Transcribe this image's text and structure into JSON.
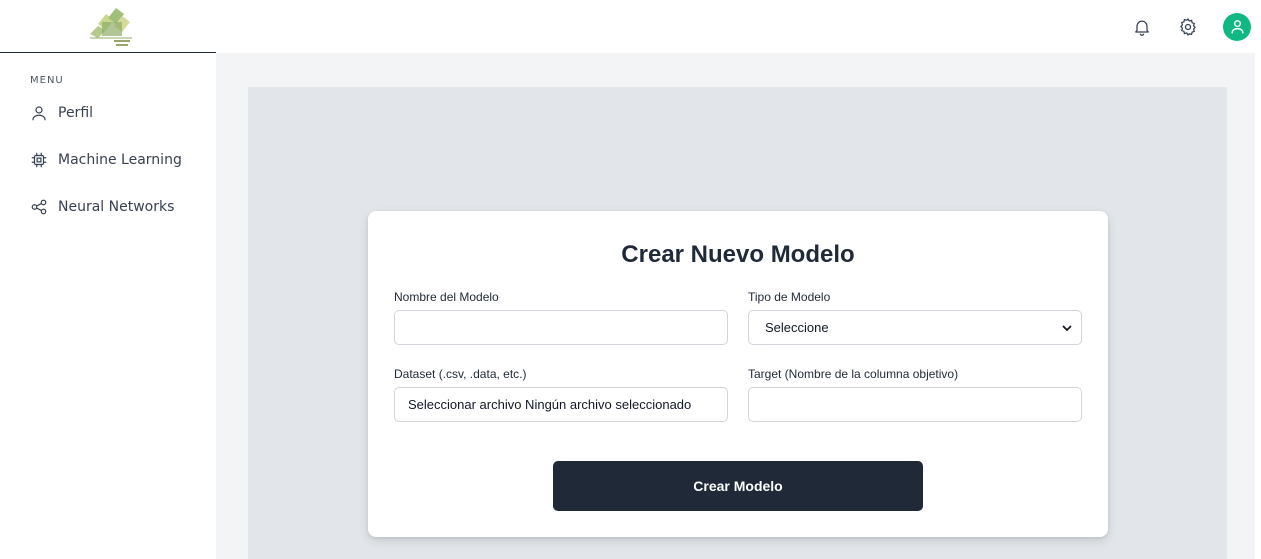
{
  "sidebar": {
    "menu_heading": "MENU",
    "items": [
      {
        "label": "Perfil",
        "icon": "user-icon"
      },
      {
        "label": "Machine Learning",
        "icon": "cpu-chip-icon"
      },
      {
        "label": "Neural Networks",
        "icon": "share-nodes-icon"
      }
    ]
  },
  "topbar": {
    "icons": [
      "bell-icon",
      "gear-icon",
      "user-avatar-icon"
    ],
    "avatar_color": "#10b981"
  },
  "form": {
    "title": "Crear Nuevo Modelo",
    "nombre_label": "Nombre del Modelo",
    "nombre_value": "",
    "tipo_label": "Tipo de Modelo",
    "tipo_selected": "Seleccione",
    "dataset_label": "Dataset (.csv, .data, etc.)",
    "dataset_value": "Seleccionar archivo Ningún archivo seleccionado",
    "target_label": "Target (Nombre de la columna objetivo)",
    "target_value": "",
    "submit_label": "Crear Modelo"
  },
  "colors": {
    "accent": "#10b981",
    "button": "#1f2937",
    "panel": "#e2e6ea"
  }
}
